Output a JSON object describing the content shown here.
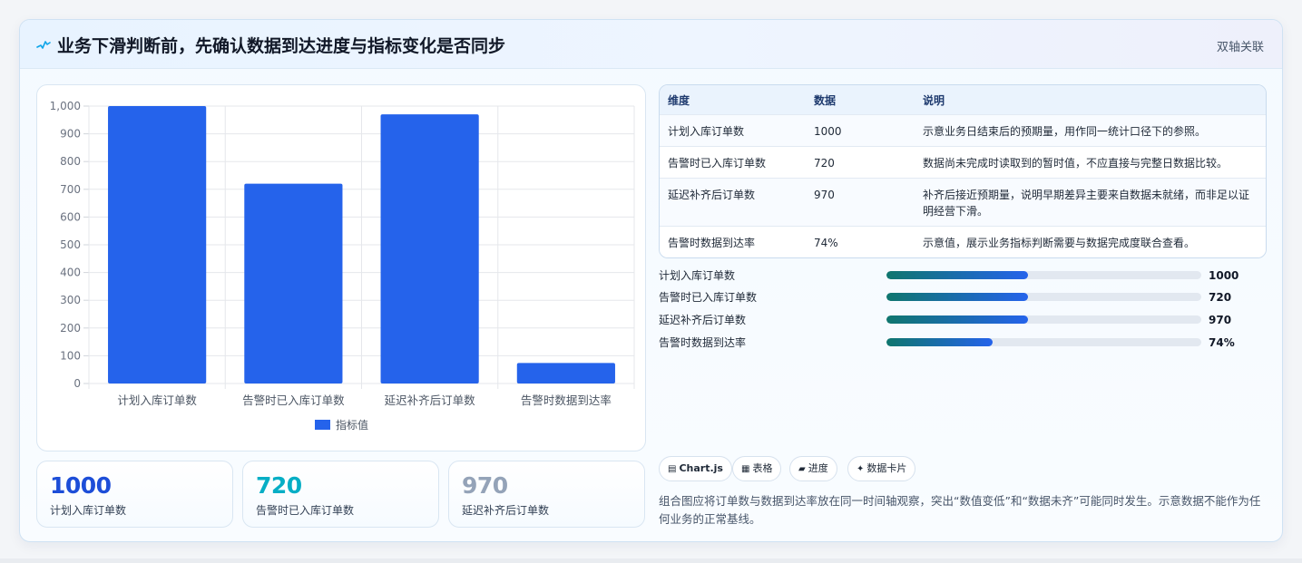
{
  "header": {
    "title": "业务下滑判断前，先确认数据到达进度与指标变化是否同步",
    "right_label": "双轴关联",
    "icon": "pulse-icon"
  },
  "chart_data": {
    "type": "bar",
    "categories": [
      "计划入库订单数",
      "告警时已入库订单数",
      "延迟补齐后订单数",
      "告警时数据到达率"
    ],
    "series": [
      {
        "name": "指标值",
        "values": [
          1000,
          720,
          970,
          74
        ],
        "color": "#2563eb"
      }
    ],
    "y_ticks": [
      "0",
      "100",
      "200",
      "300",
      "400",
      "500",
      "600",
      "700",
      "800",
      "900",
      "1,000"
    ],
    "ylim": [
      0,
      1000
    ],
    "grid": true,
    "legend": "bottom"
  },
  "kpis": [
    {
      "value": "1000",
      "label": "计划入库订单数",
      "color": "#1d4ed8"
    },
    {
      "value": "720",
      "label": "告警时已入库订单数",
      "color": "#06aec5"
    },
    {
      "value": "970",
      "label": "延迟补齐后订单数",
      "color": "#94a3b8"
    }
  ],
  "table": {
    "headers": [
      "维度",
      "数据",
      "说明"
    ],
    "rows": [
      [
        "计划入库订单数",
        "1000",
        "示意业务日结束后的预期量，用作同一统计口径下的参照。"
      ],
      [
        "告警时已入库订单数",
        "720",
        "数据尚未完成时读取到的暂时值，不应直接与完整日数据比较。"
      ],
      [
        "延迟补齐后订单数",
        "970",
        "补齐后接近预期量，说明早期差异主要来自数据未就绪，而非足以证明经营下滑。"
      ],
      [
        "告警时数据到达率",
        "74%",
        "示意值，展示业务指标判断需要与数据完成度联合查看。"
      ]
    ]
  },
  "progress": [
    {
      "label": "计划入库订单数",
      "value": "1000",
      "fraction": 0.45
    },
    {
      "label": "告警时已入库订单数",
      "value": "720",
      "fraction": 0.45
    },
    {
      "label": "延迟补齐后订单数",
      "value": "970",
      "fraction": 0.45
    },
    {
      "label": "告警时数据到达率",
      "value": "74%",
      "fraction": 0.337
    }
  ],
  "chips": [
    {
      "icon": "▤",
      "label": "Chart.js"
    },
    {
      "icon": "▦",
      "label": "表格"
    },
    {
      "icon": "▰",
      "label": "进度"
    },
    {
      "icon": "✦",
      "label": "数据卡片"
    }
  ],
  "note": "组合图应将订单数与数据到达率放在同一时间轴观察，突出“数值变低”和“数据未齐”可能同时发生。示意数据不能作为任何业务的正常基线。"
}
